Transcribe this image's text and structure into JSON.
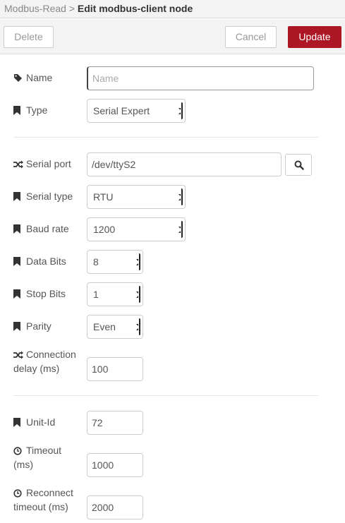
{
  "breadcrumb": {
    "parent": "Modbus-Read",
    "separator": ">",
    "current": "Edit modbus-client node"
  },
  "toolbar": {
    "delete_label": "Delete",
    "cancel_label": "Cancel",
    "update_label": "Update"
  },
  "colors": {
    "update_button": "#ad1625",
    "toolbar_bg": "#f3f3f3"
  },
  "form": {
    "name": {
      "label": "Name",
      "icon": "tag-icon",
      "placeholder": "Name",
      "value": ""
    },
    "type": {
      "label": "Type",
      "icon": "bookmark-icon",
      "value": "Serial Expert"
    },
    "serial_port": {
      "label": "Serial port",
      "icon": "random-icon",
      "value": "/dev/ttyS2",
      "search_icon": "search-icon"
    },
    "serial_type": {
      "label": "Serial type",
      "icon": "bookmark-icon",
      "value": "RTU"
    },
    "baud_rate": {
      "label": "Baud rate",
      "icon": "bookmark-icon",
      "value": "1200"
    },
    "data_bits": {
      "label": "Data Bits",
      "icon": "bookmark-icon",
      "value": "8"
    },
    "stop_bits": {
      "label": "Stop Bits",
      "icon": "bookmark-icon",
      "value": "1"
    },
    "parity": {
      "label": "Parity",
      "icon": "bookmark-icon",
      "value": "Even"
    },
    "connection_delay": {
      "label_line1": "Connection",
      "label_line2": "delay (ms)",
      "icon": "random-icon",
      "value": "100"
    },
    "unit_id": {
      "label": "Unit-Id",
      "icon": "bookmark-icon",
      "value": "72"
    },
    "timeout": {
      "label_line1": "Timeout",
      "label_line2": "(ms)",
      "icon": "clock-icon",
      "value": "1000"
    },
    "reconnect_timeout": {
      "label_line1": "Reconnect",
      "label_line2": "timeout (ms)",
      "icon": "clock-icon",
      "value": "2000"
    }
  }
}
